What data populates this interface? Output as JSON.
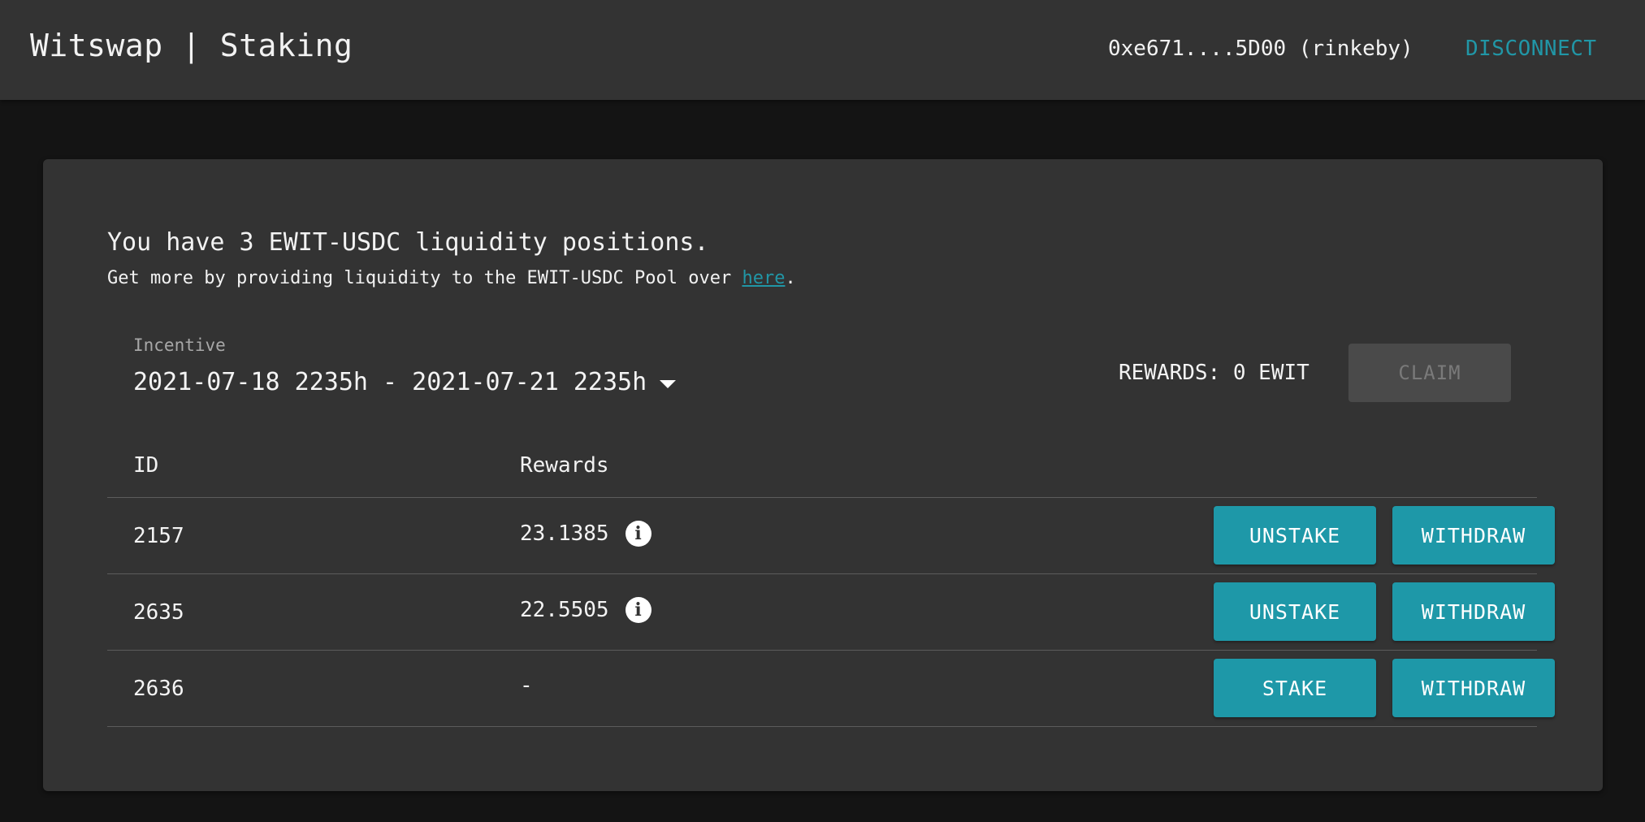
{
  "header": {
    "title": "Witswap | Staking",
    "account": "0xe671....5D00 (rinkeby)",
    "disconnect_label": "DISCONNECT"
  },
  "summary": {
    "headline": "You have 3 EWIT-USDC liquidity positions.",
    "subline_prefix": "Get more by providing liquidity to the EWIT-USDC Pool over ",
    "subline_link": "here",
    "subline_suffix": "."
  },
  "incentive": {
    "label": "Incentive",
    "selected": "2021-07-18 2235h - 2021-07-21 2235h"
  },
  "rewards": {
    "text": "REWARDS: 0 EWIT",
    "claim_label": "CLAIM"
  },
  "table": {
    "headers": {
      "id": "ID",
      "rewards": "Rewards"
    },
    "rows": [
      {
        "id": "2157",
        "reward": "23.1385",
        "info_icon": "info-icon",
        "action": "UNSTAKE",
        "withdraw": "WITHDRAW"
      },
      {
        "id": "2635",
        "reward": "22.5505",
        "info_icon": "info-icon",
        "action": "UNSTAKE",
        "withdraw": "WITHDRAW"
      },
      {
        "id": "2636",
        "reward": "-",
        "action": "STAKE",
        "withdraw": "WITHDRAW"
      }
    ]
  },
  "colors": {
    "accent": "#1e98a8",
    "link": "#2196a6",
    "surface": "#333333",
    "background": "#141414"
  }
}
